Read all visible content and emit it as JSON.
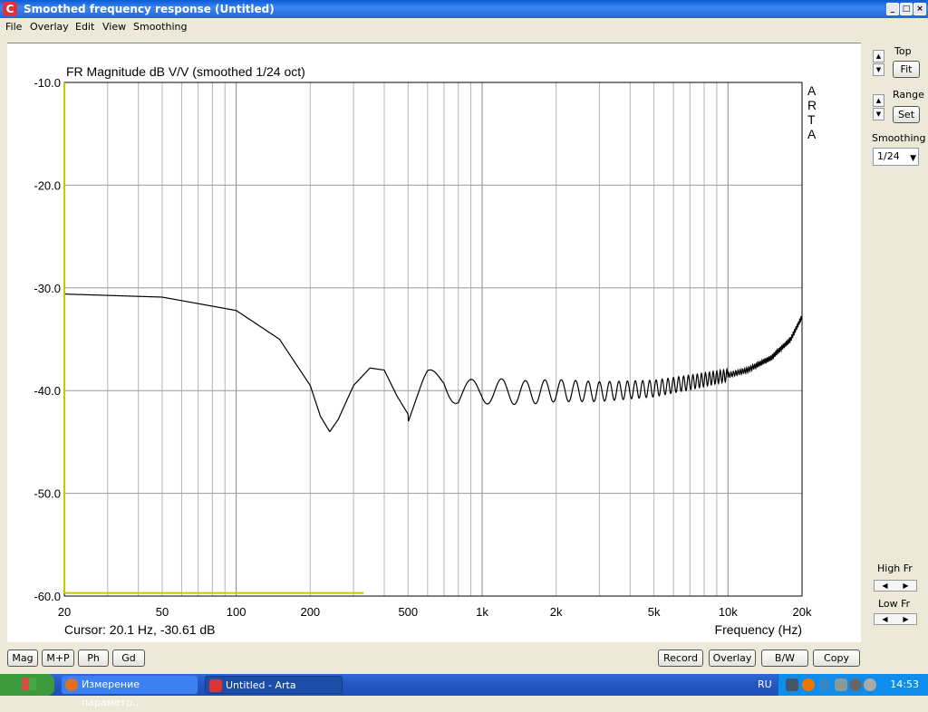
{
  "window": {
    "title": "Smoothed frequency response (Untitled)",
    "app_icon": "arta-icon"
  },
  "menu": [
    "File",
    "Overlay",
    "Edit",
    "View",
    "Smoothing"
  ],
  "right_panel": {
    "top_label": "Top",
    "fit_label": "Fit",
    "range_label": "Range",
    "set_label": "Set",
    "smoothing_label": "Smoothing",
    "smoothing_value": "1/24",
    "high_fr_label": "High Fr",
    "low_fr_label": "Low Fr"
  },
  "bottom_buttons": {
    "mag": "Mag",
    "mp": "M+P",
    "ph": "Ph",
    "gd": "Gd",
    "record": "Record",
    "overlay": "Overlay",
    "bw": "B/W",
    "copy": "Copy"
  },
  "taskbar": {
    "task1": "Измерение параметр…",
    "task2": "Untitled - Arta",
    "lang": "RU",
    "clock": "14:53"
  },
  "chart_data": {
    "type": "line",
    "title": "FR Magnitude dB V/V (smoothed 1/24 oct)",
    "watermark": "ARTA",
    "xlabel": "Frequency (Hz)",
    "ylabel": "",
    "x_scale": "log",
    "xlim": [
      20,
      20000
    ],
    "ylim": [
      -60,
      -10
    ],
    "y_ticks": [
      "-10.0",
      "-20.0",
      "-30.0",
      "-40.0",
      "-50.0",
      "-60.0"
    ],
    "y_tick_values": [
      -10,
      -20,
      -30,
      -40,
      -50,
      -60
    ],
    "x_ticks": [
      "20",
      "50",
      "100",
      "200",
      "500",
      "1k",
      "2k",
      "5k",
      "10k",
      "20k"
    ],
    "x_tick_values": [
      20,
      50,
      100,
      200,
      500,
      1000,
      2000,
      5000,
      10000,
      20000
    ],
    "grid": true,
    "cursor_text": "Cursor: 20.1 Hz, -30.61 dB",
    "series": [
      {
        "color": "#000000",
        "x": [
          20,
          50,
          100,
          150,
          200,
          220,
          240,
          260,
          300,
          350,
          400,
          450,
          500,
          550,
          600,
          700,
          800,
          1000,
          1500,
          2000,
          3000,
          5000,
          7000,
          10000,
          12000,
          15000,
          18000,
          20000
        ],
        "y": [
          -30.6,
          -30.9,
          -32.2,
          -35.0,
          -39.5,
          -42.5,
          -44.0,
          -42.8,
          -39.5,
          -37.8,
          -38.0,
          -40.5,
          -42.3,
          -41.0,
          -39.5,
          -38.6,
          -40.5,
          -40.0,
          -40.2,
          -40.0,
          -40.1,
          -39.8,
          -39.2,
          -38.5,
          -38.0,
          -36.8,
          -35.0,
          -32.8
        ],
        "oscillation": {
          "start_hz": 500,
          "end_hz": 10000,
          "amplitude_db": 1.5
        }
      },
      {
        "color": "#c8c800",
        "x": [
          20,
          20,
          330
        ],
        "y": [
          -10,
          -59.7,
          -59.7
        ]
      }
    ]
  }
}
